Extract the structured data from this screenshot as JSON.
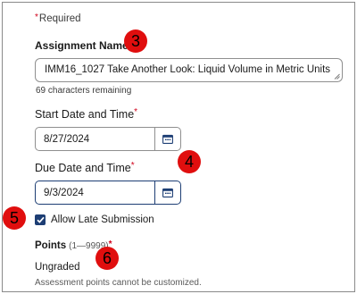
{
  "required_note": "Required",
  "assignment_name": {
    "label": "Assignment Name",
    "value": "IMM16_1027 Take Another Look: Liquid Volume in Metric Units",
    "helper": "69 characters remaining"
  },
  "start": {
    "label": "Start Date and Time",
    "value": "8/27/2024",
    "calendar_icon": "calendar-icon"
  },
  "due": {
    "label": "Due Date and Time",
    "value": "9/3/2024",
    "calendar_icon": "calendar-icon"
  },
  "late_submission": {
    "label": "Allow Late Submission",
    "checked": true
  },
  "points": {
    "label": "Points",
    "range": "(1—9999)",
    "value": "Ungraded",
    "note": "Assessment points cannot be customized."
  },
  "markers": [
    "3",
    "4",
    "5",
    "6"
  ],
  "colors": {
    "required_star": "#d0021b",
    "accent": "#1d3e74",
    "marker": "#e00e0e"
  }
}
